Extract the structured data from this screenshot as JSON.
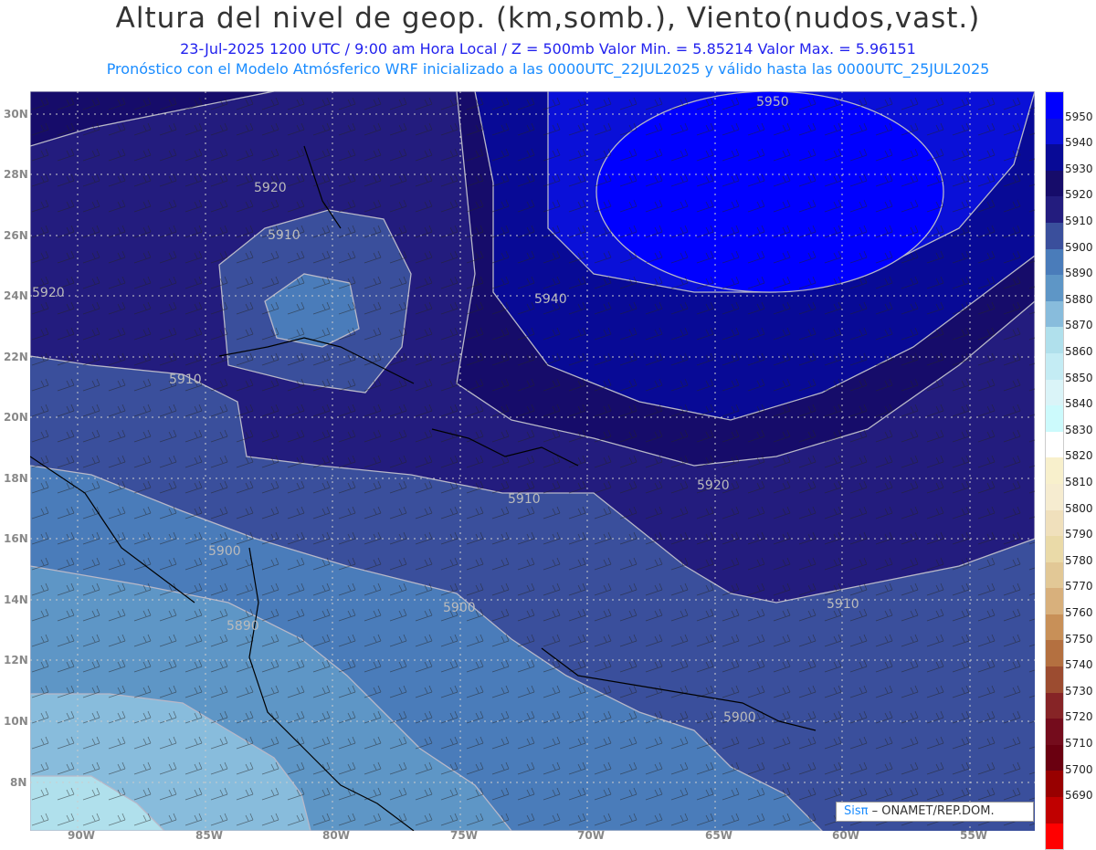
{
  "title": "Altura del nivel de geop. (km,somb.), Viento(nudos,vast.)",
  "subtitle": "23-Jul-2025   1200 UTC / 9:00 am Hora Local / Z = 500mb     Valor Min. = 5.85214   Valor Max. = 5.96151",
  "info": "Pronóstico con el Modelo Atmósferico WRF inicializado a las 0000UTC_22JUL2025 y válido hasta las  0000UTC_25JUL2025",
  "lon_labels": [
    "90W",
    "85W",
    "80W",
    "75W",
    "70W",
    "65W",
    "60W",
    "55W"
  ],
  "lat_labels": [
    "30N",
    "28N",
    "26N",
    "24N",
    "22N",
    "20N",
    "18N",
    "16N",
    "14N",
    "12N",
    "10N",
    "8N"
  ],
  "contour_labels": [
    "5950",
    "5920",
    "5910",
    "5920",
    "5940",
    "5910",
    "5920",
    "5910",
    "5900",
    "5900",
    "5890",
    "5910",
    "5900"
  ],
  "colorbar": {
    "labels": [
      "5950",
      "5940",
      "5930",
      "5920",
      "5910",
      "5900",
      "5890",
      "5880",
      "5870",
      "5860",
      "5850",
      "5840",
      "5830",
      "5820",
      "5810",
      "5800",
      "5790",
      "5780",
      "5770",
      "5760",
      "5750",
      "5740",
      "5730",
      "5720",
      "5710",
      "5700",
      "5690"
    ],
    "colors": [
      "#0000fe",
      "#0a10d8",
      "#080a96",
      "#160c6a",
      "#231c7e",
      "#3a4f9c",
      "#4a7cba",
      "#5e96c6",
      "#88bcdc",
      "#b0e0ec",
      "#c4ecf4",
      "#daf4f8",
      "#ccfafc",
      "#ffffff",
      "#f8f0cc",
      "#f6ecd0",
      "#f0e0bc",
      "#eadaa8",
      "#e2c896",
      "#d8b07c",
      "#c89058",
      "#b47040",
      "#9c4c30",
      "#862426",
      "#740c1c",
      "#6a0010",
      "#980000",
      "#c00000",
      "#ff0000"
    ]
  },
  "credit": {
    "brand": "Sisπ",
    "text": " – ONAMET/REP.DOM."
  }
}
